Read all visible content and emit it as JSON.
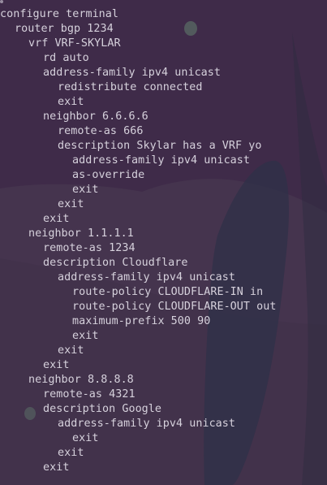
{
  "terminal": {
    "lines": [
      {
        "text": "configure terminal",
        "indent": 0
      },
      {
        "text": "router bgp 1234",
        "indent": 1
      },
      {
        "text": "vrf VRF-SKYLAR",
        "indent": 2
      },
      {
        "text": "rd auto",
        "indent": 3
      },
      {
        "text": "address-family ipv4 unicast",
        "indent": 3
      },
      {
        "text": "redistribute connected",
        "indent": 4
      },
      {
        "text": "exit",
        "indent": 4
      },
      {
        "text": "neighbor 6.6.6.6",
        "indent": 3
      },
      {
        "text": "remote-as 666",
        "indent": 4
      },
      {
        "text": "description Skylar has a VRF yo",
        "indent": 4
      },
      {
        "text": "address-family ipv4 unicast",
        "indent": 5
      },
      {
        "text": "as-override",
        "indent": 5
      },
      {
        "text": "exit",
        "indent": 5
      },
      {
        "text": "exit",
        "indent": 4
      },
      {
        "text": "exit",
        "indent": 3
      },
      {
        "text": "neighbor 1.1.1.1",
        "indent": 2
      },
      {
        "text": "remote-as 1234",
        "indent": 3
      },
      {
        "text": "description Cloudflare",
        "indent": 3
      },
      {
        "text": "address-family ipv4 unicast",
        "indent": 4
      },
      {
        "text": "route-policy CLOUDFLARE-IN in",
        "indent": 5
      },
      {
        "text": "route-policy CLOUDFLARE-OUT out",
        "indent": 5
      },
      {
        "text": "maximum-prefix 500 90",
        "indent": 5
      },
      {
        "text": "exit",
        "indent": 5
      },
      {
        "text": "exit",
        "indent": 4
      },
      {
        "text": "exit",
        "indent": 3
      },
      {
        "text": "neighbor 8.8.8.8",
        "indent": 2
      },
      {
        "text": "remote-as 4321",
        "indent": 3
      },
      {
        "text": "description Google",
        "indent": 3
      },
      {
        "text": "address-family ipv4 unicast",
        "indent": 4
      },
      {
        "text": "exit",
        "indent": 5
      },
      {
        "text": "exit",
        "indent": 4
      },
      {
        "text": "exit",
        "indent": 3
      }
    ]
  },
  "colors": {
    "background": "#3c2a47",
    "text": "#d6d1dc"
  }
}
